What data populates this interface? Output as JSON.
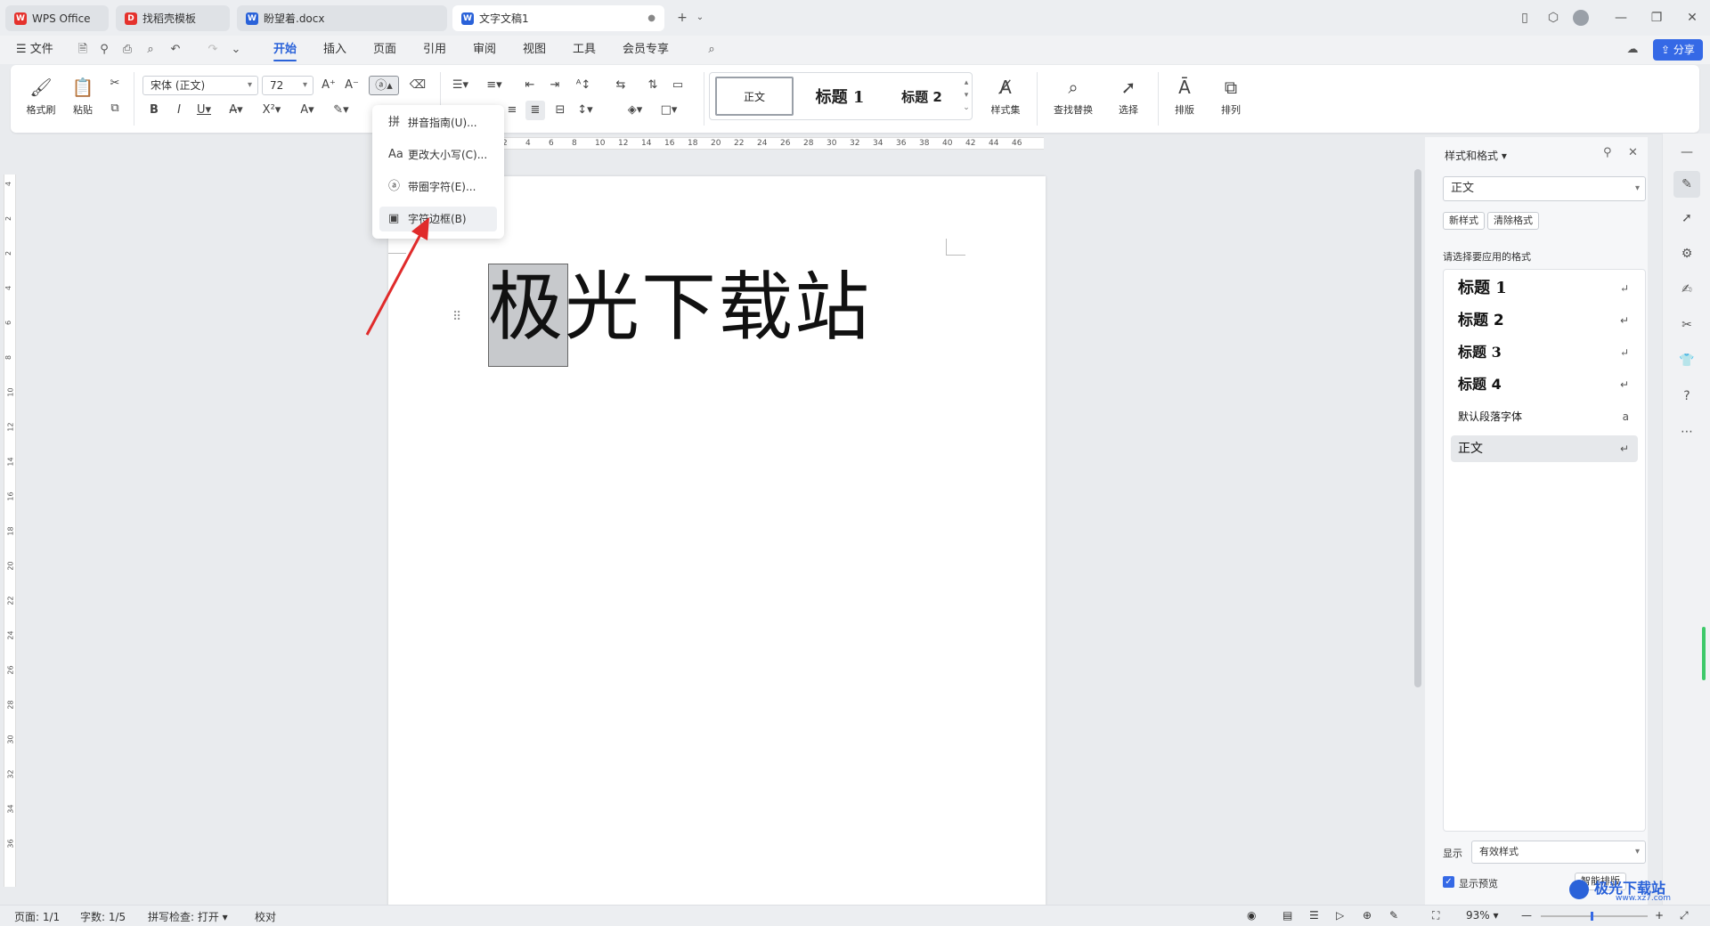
{
  "tabs": [
    {
      "label": "WPS Office",
      "color": "#e5322d"
    },
    {
      "label": "找稻壳模板",
      "color": "#e5322d"
    },
    {
      "label": "盼望着.docx",
      "color": "#2a62d9"
    },
    {
      "label": "文字文稿1",
      "color": "#2a62d9"
    }
  ],
  "menu": {
    "file": "文件",
    "tabs": [
      "开始",
      "插入",
      "页面",
      "引用",
      "审阅",
      "视图",
      "工具",
      "会员专享"
    ],
    "share": "分享"
  },
  "ribbon": {
    "format_painter": "格式刷",
    "paste": "粘贴",
    "font_name": "宋体 (正文)",
    "font_size": "72",
    "style_gallery": [
      "正文",
      "标题 1",
      "标题 2"
    ],
    "style_set": "样式集",
    "find_replace": "查找替换",
    "select": "选择",
    "layout": "排版",
    "arrange": "排列"
  },
  "dropdown": {
    "items": [
      "拼音指南(U)...",
      "更改大小写(C)...",
      "带圈字符(E)...",
      "字符边框(B)"
    ]
  },
  "ruler_h": [
    "2",
    "4",
    "6",
    "8",
    "10",
    "12",
    "14",
    "16",
    "18",
    "20",
    "22",
    "24",
    "26",
    "28",
    "30",
    "32",
    "34",
    "36",
    "38",
    "40",
    "42",
    "44",
    "46"
  ],
  "ruler_v": [
    "4",
    "2",
    "2",
    "4",
    "6",
    "8",
    "10",
    "12",
    "14",
    "16",
    "18",
    "20",
    "22",
    "24",
    "26",
    "28",
    "30",
    "32",
    "34",
    "36"
  ],
  "document": {
    "first_char": "极",
    "text": "光下载站"
  },
  "panel": {
    "title": "样式和格式",
    "current_style": "正文",
    "new_style": "新样式",
    "clear_format": "清除格式",
    "prompt": "请选择要应用的格式",
    "styles": [
      "标题 1",
      "标题 2",
      "标题 3",
      "标题 4",
      "默认段落字体",
      "正文"
    ],
    "show_label": "显示",
    "show_value": "有效样式",
    "preview_label": "显示预览",
    "smart_layout": "智能排版"
  },
  "status": {
    "page": "页面: 1/1",
    "words": "字数: 1/5",
    "spell": "拼写检查: 打开",
    "proof": "校对",
    "zoom": "93%"
  },
  "watermark": "极光下载站",
  "watermark_url": "www.xz7.com"
}
